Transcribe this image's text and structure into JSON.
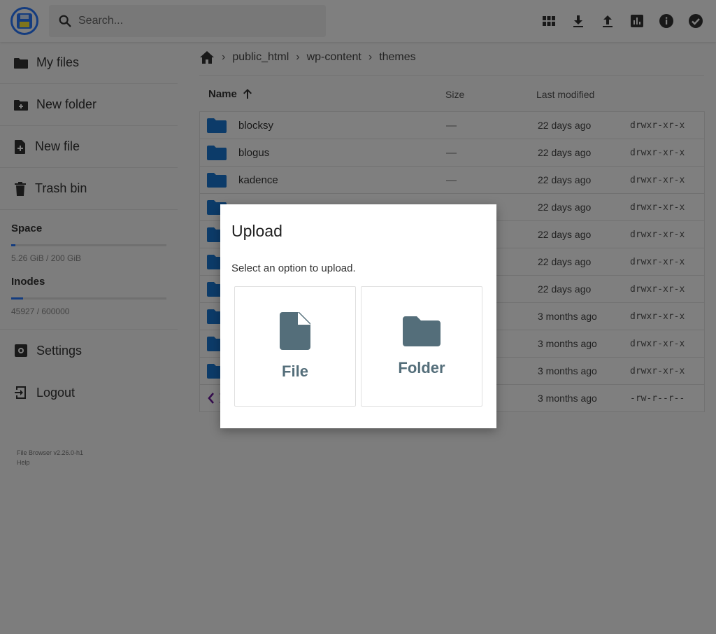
{
  "header": {
    "search_placeholder": "Search...",
    "actions": [
      "grid-view-icon",
      "download-icon",
      "upload-icon",
      "info-chart-icon",
      "info-icon",
      "select-check-icon"
    ]
  },
  "sidebar": {
    "items": [
      {
        "label": "My files",
        "icon": "folder-icon"
      },
      {
        "label": "New folder",
        "icon": "new-folder-icon"
      },
      {
        "label": "New file",
        "icon": "new-file-icon"
      },
      {
        "label": "Trash bin",
        "icon": "trash-icon"
      }
    ],
    "space": {
      "label": "Space",
      "value": "5.26 GiB / 200 GiB",
      "fraction": 0.026
    },
    "inodes": {
      "label": "Inodes",
      "value": "45927 / 600000",
      "fraction": 0.077
    },
    "settings_label": "Settings",
    "logout_label": "Logout",
    "version": "File Browser v2.26.0-h1",
    "help": "Help"
  },
  "breadcrumbs": [
    "public_html",
    "wp-content",
    "themes"
  ],
  "list": {
    "headers": {
      "name": "Name",
      "size": "Size",
      "modified": "Last modified"
    },
    "rows": [
      {
        "name": "blocksy",
        "size": "—",
        "modified": "22 days ago",
        "perm": "drwxr-xr-x",
        "type": "folder"
      },
      {
        "name": "blogus",
        "size": "—",
        "modified": "22 days ago",
        "perm": "drwxr-xr-x",
        "type": "folder"
      },
      {
        "name": "kadence",
        "size": "—",
        "modified": "22 days ago",
        "perm": "drwxr-xr-x",
        "type": "folder"
      },
      {
        "name": "",
        "size": "",
        "modified": "22 days ago",
        "perm": "drwxr-xr-x",
        "type": "folder"
      },
      {
        "name": "",
        "size": "",
        "modified": "22 days ago",
        "perm": "drwxr-xr-x",
        "type": "folder"
      },
      {
        "name": "",
        "size": "",
        "modified": "22 days ago",
        "perm": "drwxr-xr-x",
        "type": "folder"
      },
      {
        "name": "",
        "size": "",
        "modified": "22 days ago",
        "perm": "drwxr-xr-x",
        "type": "folder"
      },
      {
        "name": "",
        "size": "",
        "modified": "3 months ago",
        "perm": "drwxr-xr-x",
        "type": "folder"
      },
      {
        "name": "",
        "size": "",
        "modified": "3 months ago",
        "perm": "drwxr-xr-x",
        "type": "folder"
      },
      {
        "name": "",
        "size": "",
        "modified": "3 months ago",
        "perm": "drwxr-xr-x",
        "type": "folder"
      },
      {
        "name": "",
        "size": "",
        "modified": "3 months ago",
        "perm": "-rw-r--r--",
        "type": "code"
      }
    ]
  },
  "modal": {
    "title": "Upload",
    "text": "Select an option to upload.",
    "file_label": "File",
    "folder_label": "Folder"
  },
  "colors": {
    "accent": "#2979ff",
    "folder": "#1976d2",
    "option_icon": "#546e7a"
  }
}
